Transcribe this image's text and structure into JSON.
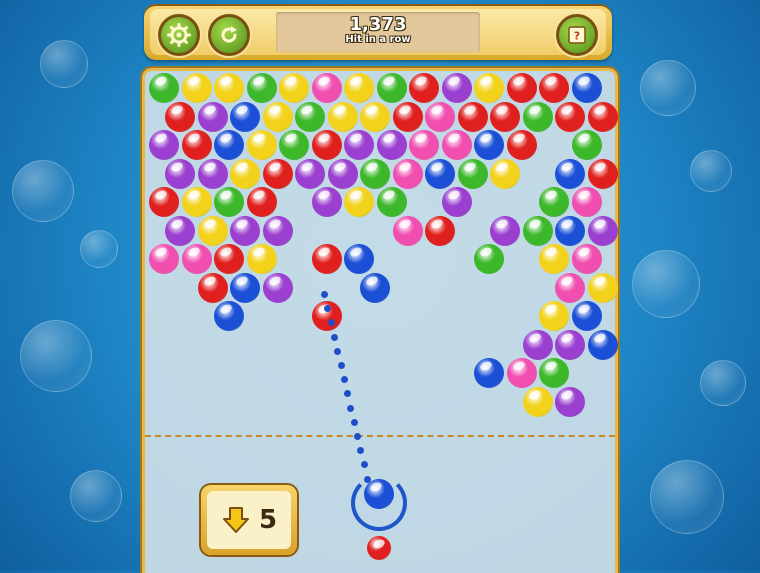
{
  "toolbar": {
    "settings_icon": "gear-icon",
    "restart_icon": "restart-icon",
    "help_icon": "help-book-icon"
  },
  "score": {
    "value": "1,373",
    "label": "Hit in a row"
  },
  "moves": {
    "icon": "down-arrow-icon",
    "value": "5"
  },
  "colors": {
    "green": "#3db82a",
    "yellow": "#f2d21a",
    "red": "#e0201e",
    "blue": "#1a4fd6",
    "purple": "#9a3fcf",
    "pink": "#f04fb0"
  },
  "board": {
    "bubbles": [
      [
        0,
        0,
        "green"
      ],
      [
        1,
        0,
        "yellow"
      ],
      [
        2,
        0,
        "yellow"
      ],
      [
        3,
        0,
        "green"
      ],
      [
        4,
        0,
        "yellow"
      ],
      [
        5,
        0,
        "pink"
      ],
      [
        6,
        0,
        "yellow"
      ],
      [
        7,
        0,
        "green"
      ],
      [
        8,
        0,
        "red"
      ],
      [
        9,
        0,
        "purple"
      ],
      [
        10,
        0,
        "yellow"
      ],
      [
        11,
        0,
        "red"
      ],
      [
        12,
        0,
        "red"
      ],
      [
        13,
        0,
        "blue"
      ],
      [
        0,
        1,
        "red"
      ],
      [
        1,
        1,
        "purple"
      ],
      [
        2,
        1,
        "blue"
      ],
      [
        3,
        1,
        "yellow"
      ],
      [
        4,
        1,
        "green"
      ],
      [
        5,
        1,
        "yellow"
      ],
      [
        6,
        1,
        "yellow"
      ],
      [
        7,
        1,
        "red"
      ],
      [
        8,
        1,
        "pink"
      ],
      [
        9,
        1,
        "red"
      ],
      [
        10,
        1,
        "red"
      ],
      [
        11,
        1,
        "green"
      ],
      [
        12,
        1,
        "red"
      ],
      [
        13,
        1,
        "red"
      ],
      [
        0,
        2,
        "purple"
      ],
      [
        1,
        2,
        "red"
      ],
      [
        2,
        2,
        "blue"
      ],
      [
        3,
        2,
        "yellow"
      ],
      [
        4,
        2,
        "green"
      ],
      [
        5,
        2,
        "red"
      ],
      [
        6,
        2,
        "purple"
      ],
      [
        7,
        2,
        "purple"
      ],
      [
        8,
        2,
        "pink"
      ],
      [
        9,
        2,
        "pink"
      ],
      [
        10,
        2,
        "blue"
      ],
      [
        11,
        2,
        "red"
      ],
      [
        13,
        2,
        "green"
      ],
      [
        0,
        3,
        "purple"
      ],
      [
        1,
        3,
        "purple"
      ],
      [
        2,
        3,
        "yellow"
      ],
      [
        3,
        3,
        "red"
      ],
      [
        4,
        3,
        "purple"
      ],
      [
        5,
        3,
        "purple"
      ],
      [
        6,
        3,
        "green"
      ],
      [
        7,
        3,
        "pink"
      ],
      [
        8,
        3,
        "blue"
      ],
      [
        9,
        3,
        "green"
      ],
      [
        10,
        3,
        "yellow"
      ],
      [
        12,
        3,
        "blue"
      ],
      [
        13,
        3,
        "red"
      ],
      [
        0,
        4,
        "red"
      ],
      [
        1,
        4,
        "yellow"
      ],
      [
        2,
        4,
        "green"
      ],
      [
        3,
        4,
        "red"
      ],
      [
        5,
        4,
        "purple"
      ],
      [
        6,
        4,
        "yellow"
      ],
      [
        7,
        4,
        "green"
      ],
      [
        9,
        4,
        "purple"
      ],
      [
        12,
        4,
        "green"
      ],
      [
        13,
        4,
        "pink"
      ],
      [
        0,
        5,
        "purple"
      ],
      [
        1,
        5,
        "yellow"
      ],
      [
        2,
        5,
        "purple"
      ],
      [
        3,
        5,
        "purple"
      ],
      [
        7,
        5,
        "pink"
      ],
      [
        8,
        5,
        "red"
      ],
      [
        10,
        5,
        "purple"
      ],
      [
        11,
        5,
        "green"
      ],
      [
        12,
        5,
        "blue"
      ],
      [
        13,
        5,
        "purple"
      ],
      [
        0,
        6,
        "pink"
      ],
      [
        1,
        6,
        "pink"
      ],
      [
        2,
        6,
        "red"
      ],
      [
        3,
        6,
        "yellow"
      ],
      [
        5,
        6,
        "red"
      ],
      [
        6,
        6,
        "blue"
      ],
      [
        10,
        6,
        "green"
      ],
      [
        12,
        6,
        "yellow"
      ],
      [
        13,
        6,
        "pink"
      ],
      [
        1,
        7,
        "red"
      ],
      [
        2,
        7,
        "blue"
      ],
      [
        3,
        7,
        "purple"
      ],
      [
        6,
        7,
        "blue"
      ],
      [
        12,
        7,
        "pink"
      ],
      [
        13,
        7,
        "yellow"
      ],
      [
        2,
        8,
        "blue"
      ],
      [
        5,
        8,
        "red"
      ],
      [
        12,
        8,
        "yellow"
      ],
      [
        13,
        8,
        "blue"
      ],
      [
        11,
        9,
        "purple"
      ],
      [
        12,
        9,
        "purple"
      ],
      [
        13,
        9,
        "blue"
      ],
      [
        10,
        10,
        "blue"
      ],
      [
        11,
        10,
        "pink"
      ],
      [
        12,
        10,
        "green"
      ],
      [
        11,
        11,
        "yellow"
      ],
      [
        12,
        11,
        "purple"
      ]
    ]
  },
  "shooter": {
    "current_color": "blue",
    "next_color": "red"
  }
}
